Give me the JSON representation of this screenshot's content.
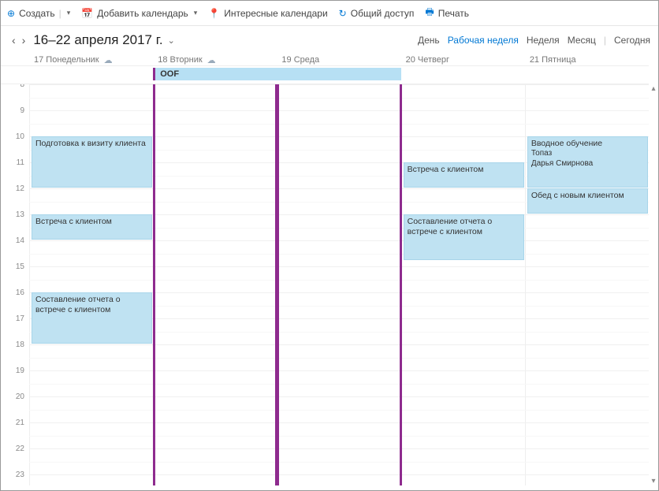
{
  "toolbar": {
    "create": "Создать",
    "addCal": "Добавить календарь",
    "interesting": "Интересные календари",
    "share": "Общий доступ",
    "print": "Печать"
  },
  "header": {
    "range": "16–22 апреля 2017 г."
  },
  "views": {
    "day": "День",
    "workWeek": "Рабочая неделя",
    "week": "Неделя",
    "month": "Месяц",
    "today": "Сегодня"
  },
  "days": [
    {
      "label": "17 Понедельник",
      "weather": true
    },
    {
      "label": "18 Вторник",
      "weather": true
    },
    {
      "label": "19 Среда",
      "weather": false
    },
    {
      "label": "20 Четверг",
      "weather": false
    },
    {
      "label": "21 Пятница",
      "weather": false
    }
  ],
  "hours": [
    "8",
    "9",
    "10",
    "11",
    "12",
    "13",
    "14",
    "15",
    "16",
    "17",
    "18",
    "19",
    "20",
    "21",
    "22",
    "23"
  ],
  "hourHeightPx": 33,
  "startHour": 8,
  "allday": {
    "title": "OOF",
    "startCol": 1,
    "span": 2
  },
  "events": [
    {
      "col": 0,
      "start": 10,
      "end": 12,
      "title": "Подготовка к визиту клиента"
    },
    {
      "col": 0,
      "start": 13,
      "end": 14,
      "title": "Встреча с клиентом"
    },
    {
      "col": 0,
      "start": 16,
      "end": 18,
      "title": "Составление отчета о встрече с клиентом"
    },
    {
      "col": 3,
      "start": 11,
      "end": 12,
      "title": "Встреча с клиентом"
    },
    {
      "col": 3,
      "start": 13,
      "end": 14.8,
      "title": "Составление отчета о встрече с клиентом"
    },
    {
      "col": 4,
      "start": 10,
      "end": 12,
      "title": "Вводное обучение",
      "lines": [
        "Топаз",
        "Дарья Смирнова"
      ]
    },
    {
      "col": 4,
      "start": 12,
      "end": 13,
      "title": "Обед с новым клиентом"
    }
  ]
}
